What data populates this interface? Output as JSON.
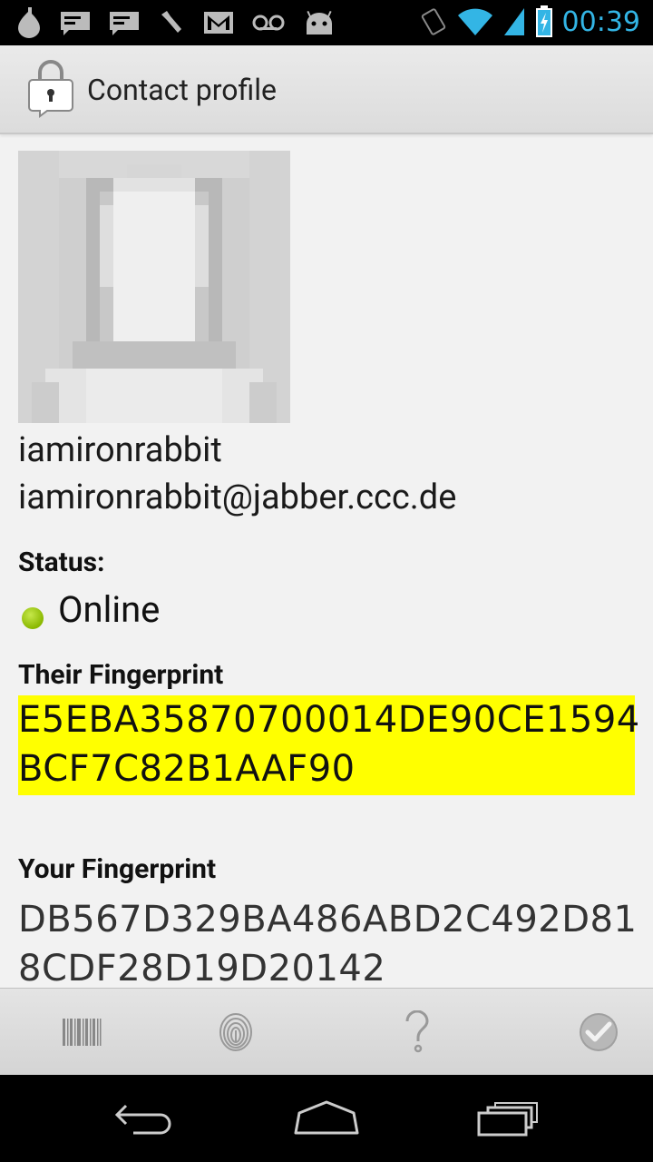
{
  "status_bar": {
    "time": "00:39",
    "left_icons": [
      "notification-drop-icon",
      "message-icon",
      "message-icon",
      "tool-icon",
      "gmail-icon",
      "voicemail-icon",
      "android-icon"
    ],
    "right_icons": [
      "rotate-icon",
      "wifi-icon",
      "signal-icon",
      "battery-charging-icon"
    ]
  },
  "action_bar": {
    "title": "Contact profile",
    "app_icon": "lock-chat-icon"
  },
  "contact": {
    "nickname": "iamironrabbit",
    "jid": "iamironrabbit@jabber.ccc.de",
    "status_label": "Status:",
    "status_value": "Online",
    "status_color": "#99cc00",
    "their_fp_label": "Their Fingerprint",
    "their_fp": "E5EBA35870700014DE90CE1594\nBCF7C82B1AAF90",
    "their_fp_highlight": "#ffff00",
    "your_fp_label": "Your Fingerprint",
    "your_fp": "DB567D329BA486ABD2C492D81\n8CDF28D19D20142"
  },
  "toolbar": {
    "buttons": [
      "barcode-icon",
      "fingerprint-icon",
      "help-icon",
      "verify-check-icon"
    ]
  },
  "nav": {
    "buttons": [
      "back-icon",
      "home-icon",
      "recent-apps-icon"
    ]
  }
}
